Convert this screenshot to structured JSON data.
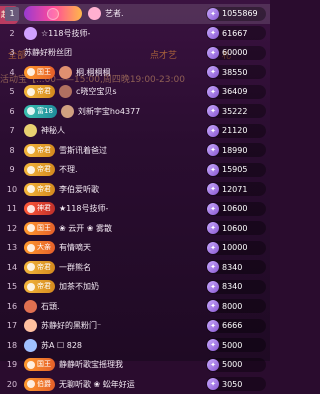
{
  "side_tab": "起单",
  "background_text": [
    {
      "text": "全部"
    },
    {
      "text": "点才艺"
    },
    {
      "text": "札"
    },
    {
      "text": "活动宝【...00——15:00,周四晚19:00-23:00"
    }
  ],
  "rows": [
    {
      "rank": "1",
      "badge": "",
      "badge_style": "big",
      "name": "艺者.",
      "score": "1055869",
      "avatar": "#ffb0d0"
    },
    {
      "rank": "2",
      "badge": "",
      "badge_style": "none",
      "name": "☆118号技师-",
      "score": "61667",
      "avatar": "#d0a0ff"
    },
    {
      "rank": "3",
      "badge": "",
      "badge_style": "none",
      "name": "苏静好粉丝团",
      "score": "60000",
      "avatar": ""
    },
    {
      "rank": "4",
      "badge": "国王",
      "badge_style": "b-orange",
      "name": "桐.桐桐桐",
      "score": "38550",
      "avatar": "#e09070"
    },
    {
      "rank": "5",
      "badge": "帝君",
      "badge_style": "b-gold",
      "name": "c晓空宝贝s",
      "score": "36409",
      "avatar": "#b07060"
    },
    {
      "rank": "6",
      "badge": "富18",
      "badge_style": "b-teal",
      "name": "刘新宇宝ho4377",
      "score": "35222",
      "avatar": "#d0a080"
    },
    {
      "rank": "7",
      "badge": "",
      "badge_style": "none",
      "name": "神秘人",
      "score": "21120",
      "avatar": "#e8d070"
    },
    {
      "rank": "8",
      "badge": "帝君",
      "badge_style": "b-gold",
      "name": "雪斯讯着爸过",
      "score": "18990",
      "avatar": ""
    },
    {
      "rank": "9",
      "badge": "帝君",
      "badge_style": "b-gold",
      "name": "不理.",
      "score": "15905",
      "avatar": ""
    },
    {
      "rank": "10",
      "badge": "帝君",
      "badge_style": "b-gold",
      "name": "李伯爱听歌",
      "score": "12071",
      "avatar": ""
    },
    {
      "rank": "11",
      "badge": "神君",
      "badge_style": "b-red",
      "name": "★118号技师-",
      "score": "10600",
      "avatar": ""
    },
    {
      "rank": "12",
      "badge": "国王",
      "badge_style": "b-orange",
      "name": "❀ 云开 ❀ 雾散",
      "score": "10600",
      "avatar": ""
    },
    {
      "rank": "13",
      "badge": "大亲",
      "badge_style": "b-orange",
      "name": "有情嘀天",
      "score": "10000",
      "avatar": ""
    },
    {
      "rank": "14",
      "badge": "帝君",
      "badge_style": "b-gold",
      "name": "一群熊名",
      "score": "8340",
      "avatar": ""
    },
    {
      "rank": "15",
      "badge": "帝君",
      "badge_style": "b-gold",
      "name": "加茶不加奶",
      "score": "8340",
      "avatar": ""
    },
    {
      "rank": "16",
      "badge": "",
      "badge_style": "none",
      "name": "石頭.",
      "score": "8000",
      "avatar": "#e07050"
    },
    {
      "rank": "17",
      "badge": "",
      "badge_style": "none",
      "name": "苏静好的黑粉门⁻",
      "score": "6666",
      "avatar": "#ffc0a0"
    },
    {
      "rank": "18",
      "badge": "",
      "badge_style": "none",
      "name": "苏A ☐ 828",
      "score": "5000",
      "avatar": "#a0c0ff"
    },
    {
      "rank": "19",
      "badge": "国王",
      "badge_style": "b-orange",
      "name": "静静听歌宝摇理我",
      "score": "5000",
      "avatar": ""
    },
    {
      "rank": "20",
      "badge": "伯爵",
      "badge_style": "b-orange",
      "name": "无聊听歌 ❀ 蚣年好运",
      "score": "3050",
      "avatar": ""
    }
  ]
}
